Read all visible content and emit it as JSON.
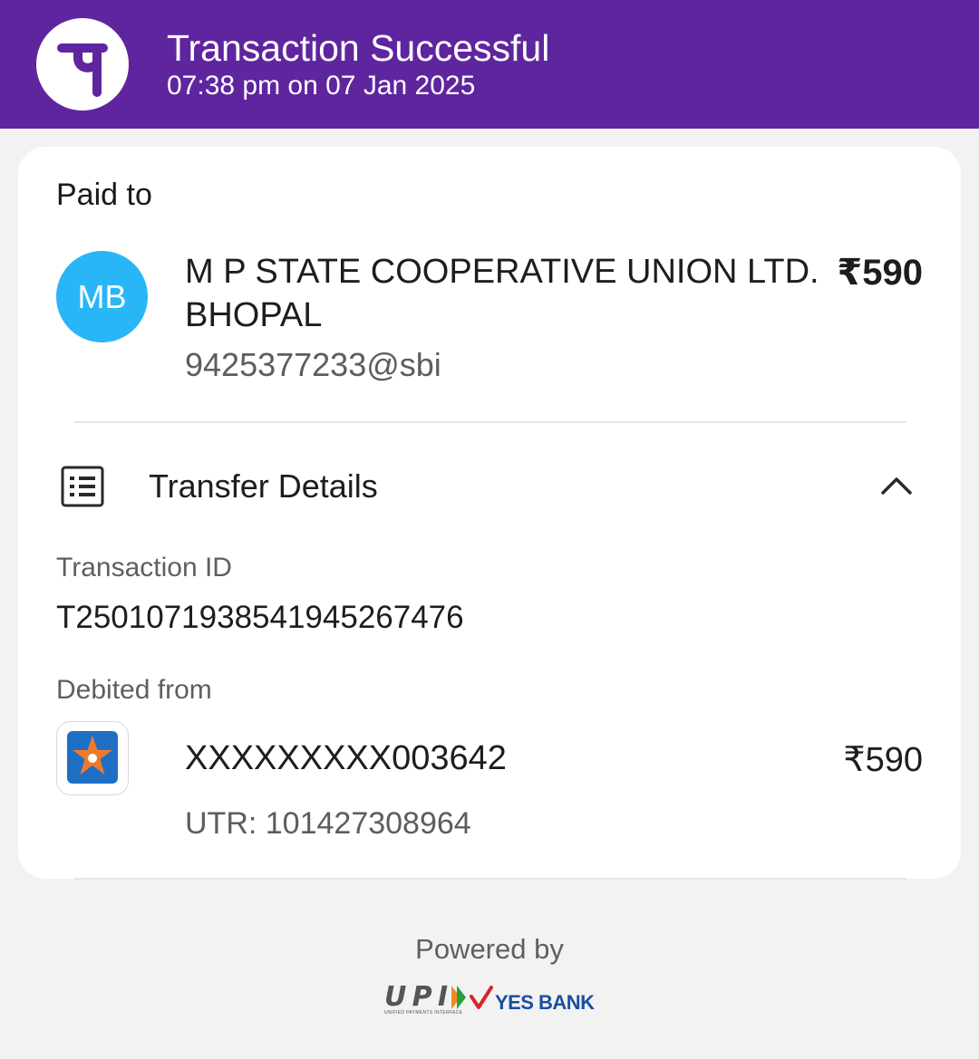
{
  "header": {
    "title": "Transaction Successful",
    "datetime": "07:38 pm on 07 Jan 2025",
    "logo_icon": "phonepe-logo-icon",
    "background_color": "#5f259f"
  },
  "payee": {
    "section_label": "Paid to",
    "avatar_initials": "MB",
    "avatar_color": "#29b6f6",
    "name": "M P STATE COOPERATIVE UNION LTD. BHOPAL",
    "upi_id": "9425377233@sbi",
    "amount": "₹590"
  },
  "transfer_details": {
    "title": "Transfer Details",
    "icon": "receipt-list-icon",
    "toggle_icon": "chevron-up-icon",
    "transaction_id_label": "Transaction ID",
    "transaction_id": "T2501071938541945267476",
    "debited_from_label": "Debited from",
    "bank_icon": "bank-star-icon",
    "account_number": "XXXXXXXXX003642",
    "amount": "₹590",
    "utr": "UTR: 101427308964"
  },
  "footer": {
    "powered_by": "Powered by",
    "upi_logo_text": "UPI",
    "upi_tagline": "UNIFIED PAYMENTS INTERFACE",
    "bank_logo_text": "YES BANK"
  }
}
